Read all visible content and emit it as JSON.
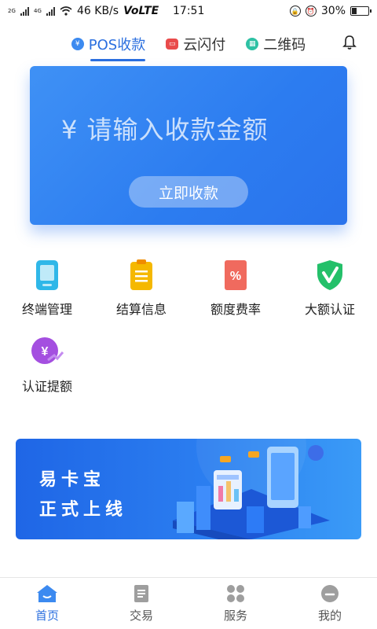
{
  "status_bar": {
    "network_small_1": "2G",
    "network_small_2": "4G",
    "speed": "46 KB/s",
    "volte": "VoLTE",
    "time": "17:51",
    "battery": "30%",
    "battery_level": 0.3
  },
  "top_tabs": [
    {
      "label": "POS收款",
      "icon": "yuan-circle-icon",
      "active": true
    },
    {
      "label": "云闪付",
      "icon": "card-icon",
      "active": false
    },
    {
      "label": "二维码",
      "icon": "qrcode-icon",
      "active": false
    }
  ],
  "hero": {
    "amount_placeholder": "¥ 请输入收款金额",
    "pay_button": "立即收款"
  },
  "features": [
    {
      "label": "终端管理",
      "icon": "terminal-icon",
      "color": "#2fb7e8"
    },
    {
      "label": "结算信息",
      "icon": "clipboard-icon",
      "color": "#f5b800"
    },
    {
      "label": "额度费率",
      "icon": "percent-icon",
      "color": "#f06a5e"
    },
    {
      "label": "大额认证",
      "icon": "shield-check-icon",
      "color": "#24c06a"
    },
    {
      "label": "认证提额",
      "icon": "yuan-up-icon",
      "color": "#a44fe0"
    }
  ],
  "banner": {
    "line1": "易卡宝",
    "line2": "正式上线"
  },
  "bottom_nav": [
    {
      "label": "首页",
      "icon": "home-icon",
      "active": true
    },
    {
      "label": "交易",
      "icon": "document-icon",
      "active": false
    },
    {
      "label": "服务",
      "icon": "grid-icon",
      "active": false
    },
    {
      "label": "我的",
      "icon": "user-icon",
      "active": false
    }
  ],
  "colors": {
    "accent": "#2b6fdf",
    "hero_bg": "#3b88f3"
  }
}
